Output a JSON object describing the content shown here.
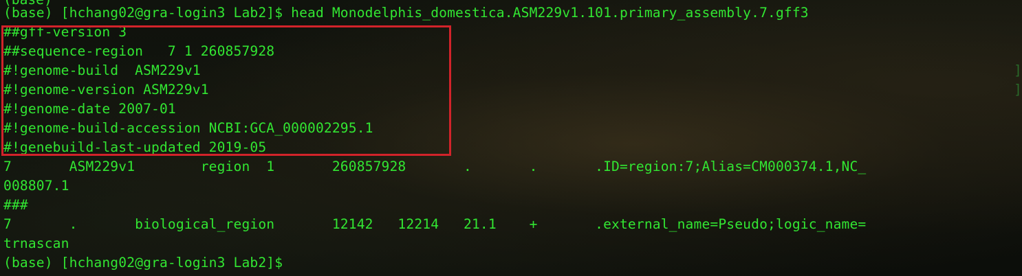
{
  "terminal": {
    "top_fragment": "(base)",
    "lines": [
      "(base) [hchang02@gra-login3 Lab2]$ head Monodelphis_domestica.ASM229v1.101.primary_assembly.7.gff3",
      "##gff-version 3",
      "##sequence-region   7 1 260857928",
      "#!genome-build  ASM229v1",
      "#!genome-version ASM229v1",
      "#!genome-date 2007-01",
      "#!genome-build-accession NCBI:GCA_000002295.1",
      "#!genebuild-last-updated 2019-05",
      "7       ASM229v1        region  1       260857928       .       .       .ID=region:7;Alias=CM000374.1,NC_",
      "008807.1",
      "###",
      "7       .       biological_region       12142   12214   21.1    +       .external_name=Pseudo;logic_name=",
      "trnascan",
      "(base) [hchang02@gra-login3 Lab2]$ "
    ],
    "edge_marks": [
      "]",
      "]"
    ]
  },
  "colors": {
    "text": "#32e632",
    "highlight_box": "#d2232a",
    "background": "#0d0f0a"
  }
}
